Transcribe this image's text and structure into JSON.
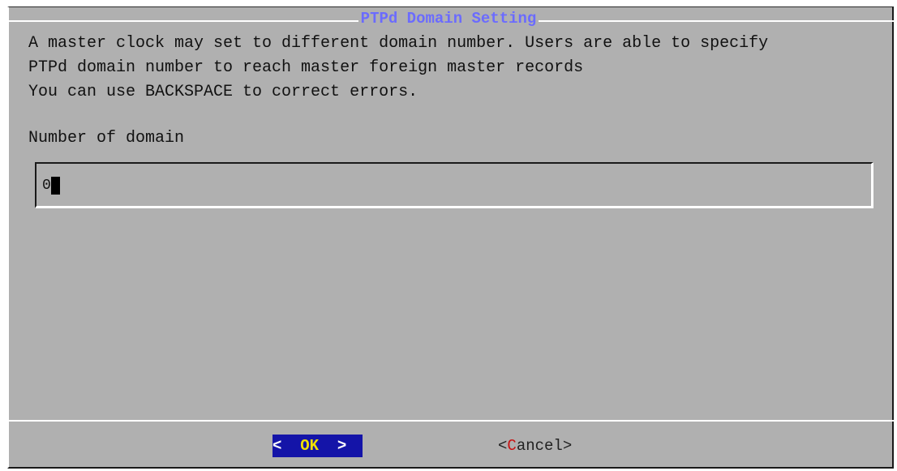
{
  "dialog": {
    "title": "PTPd Domain Setting",
    "description_lines": [
      "A master clock may set to different domain number. Users are able to specify",
      "PTPd domain number to reach master foreign master records",
      "You can use BACKSPACE to correct errors."
    ],
    "field_label": "Number of domain",
    "input_value": "0"
  },
  "buttons": {
    "ok_left": "< ",
    "ok_label": "OK",
    "ok_right": " >",
    "cancel_left": "<",
    "cancel_hotkey": "C",
    "cancel_rest": "ancel",
    "cancel_right": ">"
  },
  "colors": {
    "dialog_bg": "#b0b0b0",
    "title": "#6b6bff",
    "ok_bg": "#1414a8",
    "ok_label": "#f0e000",
    "hotkey": "#c81414"
  }
}
